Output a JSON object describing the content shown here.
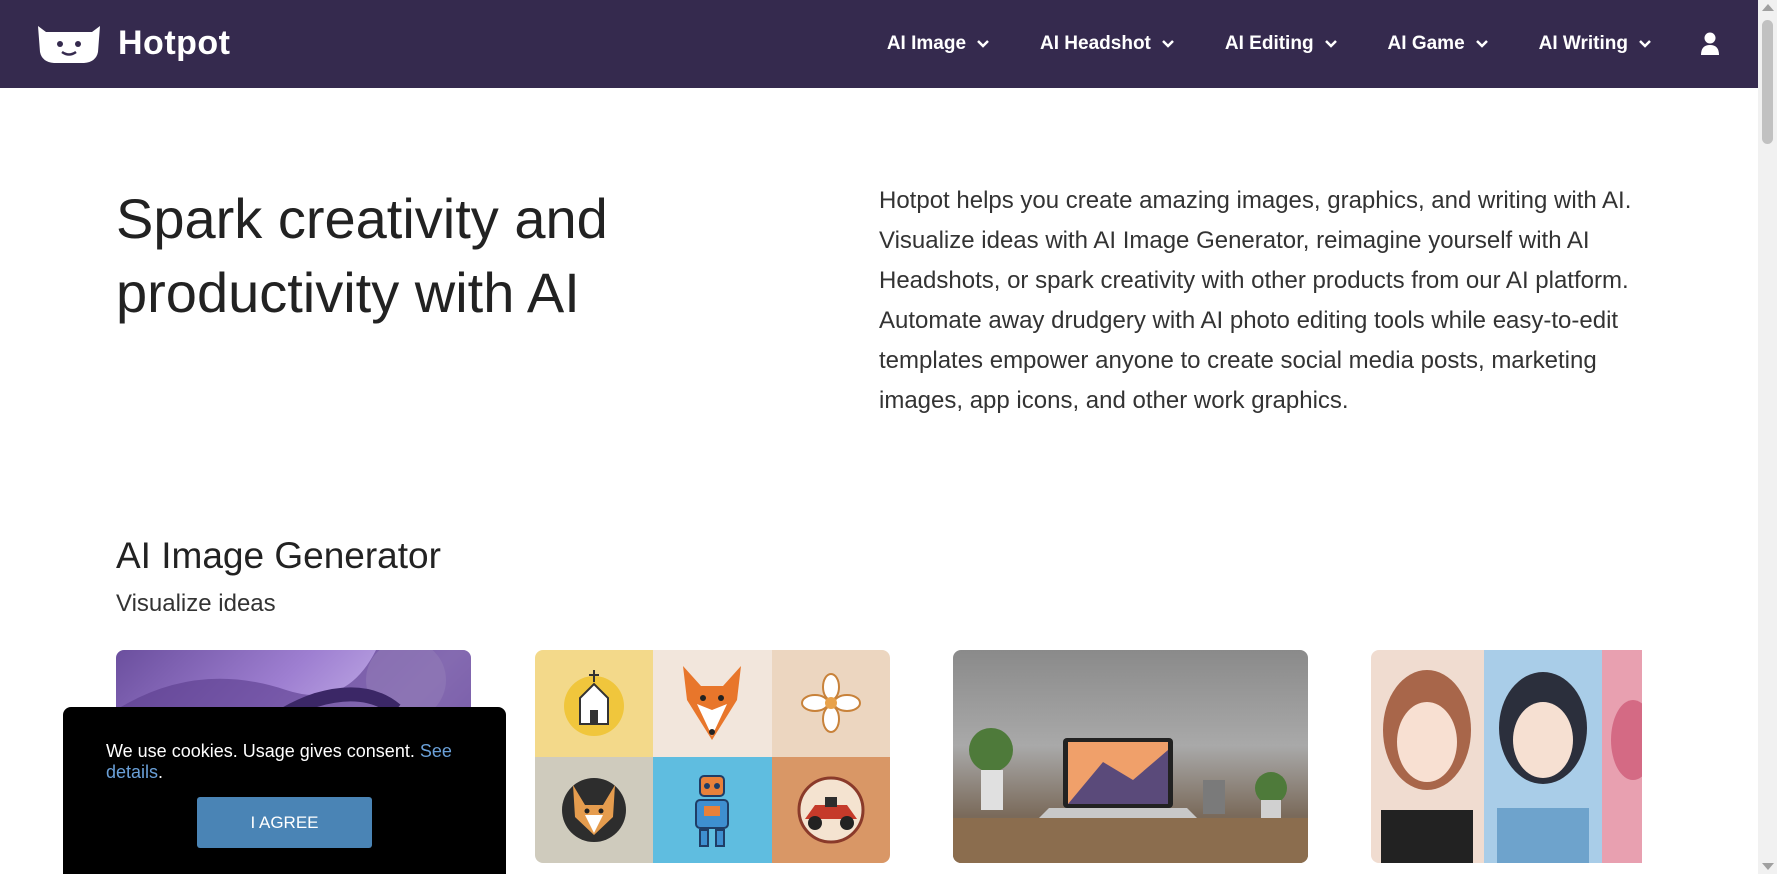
{
  "nav": {
    "logo_text": "Hotpot",
    "items": [
      {
        "label": "AI Image"
      },
      {
        "label": "AI Headshot"
      },
      {
        "label": "AI Editing"
      },
      {
        "label": "AI Game"
      },
      {
        "label": "AI Writing"
      }
    ],
    "user_icon": "user-icon"
  },
  "hero": {
    "title": "Spark creativity and productivity with AI",
    "description": "Hotpot helps you create amazing images, graphics, and writing with AI. Visualize ideas with AI Image Generator, reimagine yourself with AI Headshots, or spark creativity with other products from our AI platform. Automate away drudgery with AI photo editing tools while easy-to-edit templates empower anyone to create social media posts, marketing images, app icons, and other work graphics."
  },
  "section": {
    "title": "AI Image Generator",
    "subtitle": "Visualize ideas"
  },
  "cards": [
    {
      "image": "purple-fantasy-illustration"
    },
    {
      "image": "logo-icon-grid",
      "tiles": [
        "church-icon",
        "fox-icon",
        "flower-icon",
        "corgi-icon",
        "robot-icon",
        "racecar-icon"
      ]
    },
    {
      "image": "laptop-desk-photo"
    },
    {
      "image": "anime-portraits"
    }
  ],
  "cookie": {
    "text": "We use cookies. Usage gives consent. ",
    "link": "See details",
    "period": ".",
    "button": "I AGREE"
  },
  "colors": {
    "nav_bg": "#352a4e",
    "button": "#4a84b5",
    "link": "#6aa0d8"
  }
}
